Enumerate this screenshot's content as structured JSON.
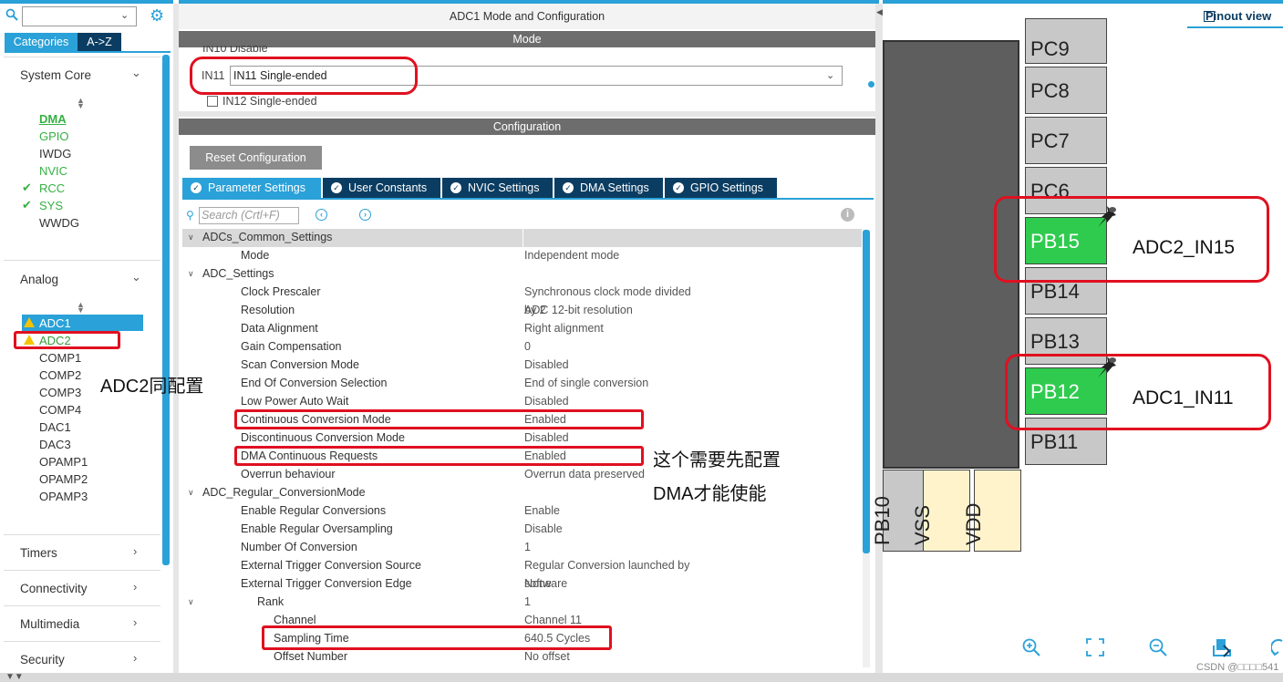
{
  "left_panel": {
    "tabs": [
      "Categories",
      "A->Z"
    ],
    "system_core": {
      "title": "System Core",
      "items": [
        {
          "label": "DMA",
          "state": "green-underline"
        },
        {
          "label": "GPIO",
          "state": "green"
        },
        {
          "label": "IWDG",
          "state": "normal"
        },
        {
          "label": "NVIC",
          "state": "green"
        },
        {
          "label": "RCC",
          "state": "checked"
        },
        {
          "label": "SYS",
          "state": "checked"
        },
        {
          "label": "WWDG",
          "state": "normal"
        }
      ]
    },
    "analog": {
      "title": "Analog",
      "items": [
        {
          "label": "ADC1",
          "state": "selected-warning"
        },
        {
          "label": "ADC2",
          "state": "warning"
        },
        {
          "label": "COMP1"
        },
        {
          "label": "COMP2"
        },
        {
          "label": "COMP3"
        },
        {
          "label": "COMP4"
        },
        {
          "label": "DAC1"
        },
        {
          "label": "DAC3"
        },
        {
          "label": "OPAMP1"
        },
        {
          "label": "OPAMP2"
        },
        {
          "label": "OPAMP3"
        }
      ]
    },
    "groups": [
      "Timers",
      "Connectivity",
      "Multimedia",
      "Security"
    ]
  },
  "middle_panel": {
    "title": "ADC1 Mode and Configuration",
    "mode_header": "Mode",
    "in10_label": "IN10 Disable",
    "in11_label": "IN11",
    "in11_value": "IN11 Single-ended",
    "in12_label": "IN12 Single-ended",
    "config_header": "Configuration",
    "reset_button": "Reset Configuration",
    "tabs": [
      "Parameter Settings",
      "User Constants",
      "NVIC Settings",
      "DMA Settings",
      "GPIO Settings"
    ],
    "search_placeholder": "Search (Crtl+F)",
    "params": [
      {
        "key": "ADCs_Common_Settings",
        "value": "",
        "level": 0,
        "group": true
      },
      {
        "key": "Mode",
        "value": "Independent mode",
        "level": 1
      },
      {
        "key": "ADC_Settings",
        "value": "",
        "level": 0,
        "group": true
      },
      {
        "key": "Clock Prescaler",
        "value": "Synchronous clock mode divided by 2",
        "level": 1
      },
      {
        "key": "Resolution",
        "value": "ADC 12-bit resolution",
        "level": 1
      },
      {
        "key": "Data Alignment",
        "value": "Right alignment",
        "level": 1
      },
      {
        "key": "Gain Compensation",
        "value": "0",
        "level": 1
      },
      {
        "key": "Scan Conversion Mode",
        "value": "Disabled",
        "level": 1
      },
      {
        "key": "End Of Conversion Selection",
        "value": "End of single conversion",
        "level": 1
      },
      {
        "key": "Low Power Auto Wait",
        "value": "Disabled",
        "level": 1
      },
      {
        "key": "Continuous Conversion Mode",
        "value": "Enabled",
        "level": 1
      },
      {
        "key": "Discontinuous Conversion Mode",
        "value": "Disabled",
        "level": 1
      },
      {
        "key": "DMA Continuous Requests",
        "value": "Enabled",
        "level": 1
      },
      {
        "key": "Overrun behaviour",
        "value": "Overrun data preserved",
        "level": 1
      },
      {
        "key": "ADC_Regular_ConversionMode",
        "value": "",
        "level": 0,
        "group": true
      },
      {
        "key": "Enable Regular Conversions",
        "value": "Enable",
        "level": 1
      },
      {
        "key": "Enable Regular Oversampling",
        "value": "Disable",
        "level": 1
      },
      {
        "key": "Number Of Conversion",
        "value": "1",
        "level": 1
      },
      {
        "key": "External Trigger Conversion Source",
        "value": "Regular Conversion launched by software",
        "level": 1
      },
      {
        "key": "External Trigger Conversion Edge",
        "value": "None",
        "level": 1
      },
      {
        "key": "Rank",
        "value": "1",
        "level": 2,
        "group": true
      },
      {
        "key": "Channel",
        "value": "Channel 11",
        "level": 3
      },
      {
        "key": "Sampling Time",
        "value": "640.5 Cycles",
        "level": 3
      },
      {
        "key": "Offset Number",
        "value": "No offset",
        "level": 3
      }
    ]
  },
  "right_panel": {
    "tab": "Pinout view",
    "pins": [
      {
        "label": "PC9",
        "state": "normal"
      },
      {
        "label": "PC8",
        "state": "normal"
      },
      {
        "label": "PC7",
        "state": "normal"
      },
      {
        "label": "PC6",
        "state": "normal"
      },
      {
        "label": "PB15",
        "state": "assigned"
      },
      {
        "label": "PB14",
        "state": "normal"
      },
      {
        "label": "PB13",
        "state": "normal"
      },
      {
        "label": "PB12",
        "state": "assigned"
      },
      {
        "label": "PB11",
        "state": "normal"
      }
    ],
    "bottom_pins": [
      {
        "label": "PB10",
        "color": "#c8c8c8"
      },
      {
        "label": "VSS",
        "color": "#fff3cc"
      },
      {
        "label": "VDD",
        "color": "#fff3cc"
      }
    ],
    "signals": {
      "pb15": "ADC2_IN15",
      "pb12": "ADC1_IN11"
    }
  },
  "annotations": {
    "adc2_note": "ADC2同配置",
    "dma_note_line1": "这个需要先配置",
    "dma_note_line2": "DMA才能使能"
  },
  "watermark": "CSDN @□□□□541",
  "colors": {
    "accent": "#2aa1d8",
    "navy": "#0b3d62",
    "pin_green": "#2fcb4e",
    "annotation_red": "#e01020",
    "status_green": "#36b043",
    "warning": "#f5c300"
  }
}
